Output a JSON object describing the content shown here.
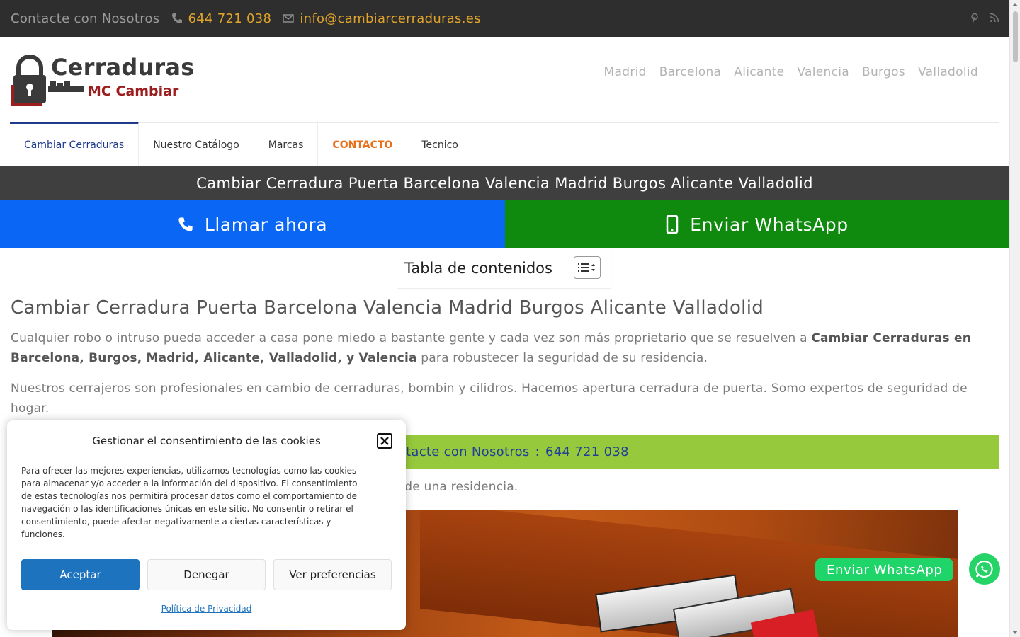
{
  "topbar": {
    "contact_label": "Contacte con Nosotros",
    "phone": "644 721 038",
    "email": "info@cambiarcerraduras.es",
    "social": [
      "pinterest-icon",
      "rss-icon"
    ]
  },
  "logo": {
    "line1": "Cerraduras",
    "line2": "MC Cambiar"
  },
  "city_nav": [
    "Madrid",
    "Barcelona",
    "Alicante",
    "Valencia",
    "Burgos",
    "Valladolid"
  ],
  "main_nav": [
    {
      "label": "Cambiar Cerraduras",
      "active": true
    },
    {
      "label": "Nuestro Catálogo"
    },
    {
      "label": "Marcas"
    },
    {
      "label": "CONTACTO",
      "highlight": true
    },
    {
      "label": "Tecnico"
    }
  ],
  "title_band": "Cambiar Cerradura Puerta Barcelona Valencia Madrid Burgos Alicante Valladolid",
  "cta": {
    "call": "Llamar ahora",
    "whatsapp": "Enviar WhatsApp"
  },
  "toc": {
    "title": "Tabla de contenidos"
  },
  "article": {
    "heading": "Cambiar Cerradura Puerta Barcelona Valencia Madrid Burgos Alicante Valladolid",
    "p1_a": "Cualquier robo o intruso pueda acceder a casa pone miedo a bastante gente y cada vez son más proprietario que se resuelven a ",
    "p1_bold": "Cambiar Cerraduras en Barcelona, Burgos, Madrid, Alicante, Valladolid, y Valencia",
    "p1_b": " para robustecer la seguridad de su residencia.",
    "p2": "Nuestros cerrajeros son profesionales en cambio de cerraduras, bombin y cilidros. Hacemos apertura cerradura de puerta. Somo expertos de seguridad de hogar.",
    "green_label": "Contacte con Nosotros",
    "green_sep": ":",
    "green_phone": "644 721 038",
    "p3_visible": "a de una residencia."
  },
  "floating": {
    "whatsapp": "Enviar WhatsApp"
  },
  "cookie": {
    "title": "Gestionar el consentimiento de las cookies",
    "body": "Para ofrecer las mejores experiencias, utilizamos tecnologías como las cookies para almacenar y/o acceder a la información del dispositivo. El consentimiento de estas tecnologías nos permitirá procesar datos como el comportamiento de navegación o las identificaciones únicas en este sitio. No consentir o retirar el consentimiento, puede afectar negativamente a ciertas características y funciones.",
    "accept": "Aceptar",
    "deny": "Denegar",
    "prefs": "Ver preferencias",
    "privacy": "Política de Privacidad"
  },
  "colors": {
    "accent_orange": "#e0a42a",
    "call_blue": "#0a66f5",
    "whatsapp_green": "#0f8a0f",
    "contact_bar_green": "#97c93c",
    "accept_blue": "#1e73be"
  }
}
